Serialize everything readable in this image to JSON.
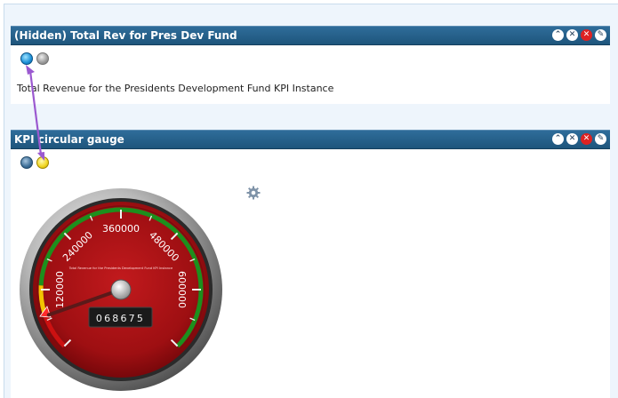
{
  "panel1": {
    "title": "(Hidden) Total Rev for Pres Dev Fund",
    "description": "Total Revenue for the Presidents Development Fund KPI Instance"
  },
  "panel2": {
    "title": "KPI circular gauge"
  },
  "header_icons": [
    "collapse-icon",
    "close-icon",
    "remove-icon",
    "edit-icon"
  ],
  "gauge": {
    "caption": "Total Revenue for the Presidents Development Fund KPI Instance",
    "odometer": "068675",
    "scale_labels": [
      "120000",
      "240000",
      "360000",
      "480000",
      "600000"
    ],
    "min": 0,
    "max": 720000,
    "value": 68675,
    "colors": {
      "face": "#9e0f12",
      "green_band": "#1d8f1d",
      "yellow_band": "#f2c400",
      "red_band": "#cc1111"
    }
  },
  "colors": {
    "header": "#2a6690",
    "arrow": "#9b59d0"
  }
}
